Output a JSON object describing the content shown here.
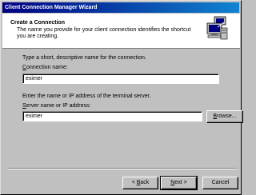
{
  "window": {
    "title": "Client Connection Manager Wizard"
  },
  "header": {
    "title": "Create a Connection",
    "description": "The name you provide for your client connection identifies the shortcut you are creating.",
    "icon": "computer-wizard-icon"
  },
  "form": {
    "connection_instruction": "Type a short, descriptive name for the connection.",
    "connection_label_prefix": "C",
    "connection_label_rest": "onnection name:",
    "connection_value": "eximer",
    "server_instruction": "Enter the name or IP address of the terminal server.",
    "server_label_prefix": "S",
    "server_label_rest": "erver name or IP address:",
    "server_value": "eximer",
    "browse_prefix": "B",
    "browse_rest": "rowse..."
  },
  "footer": {
    "back_lt": "< ",
    "back_ul": "B",
    "back_rest": "ack",
    "next_ul": "N",
    "next_rest": "ext >",
    "cancel_label": "Cancel"
  }
}
